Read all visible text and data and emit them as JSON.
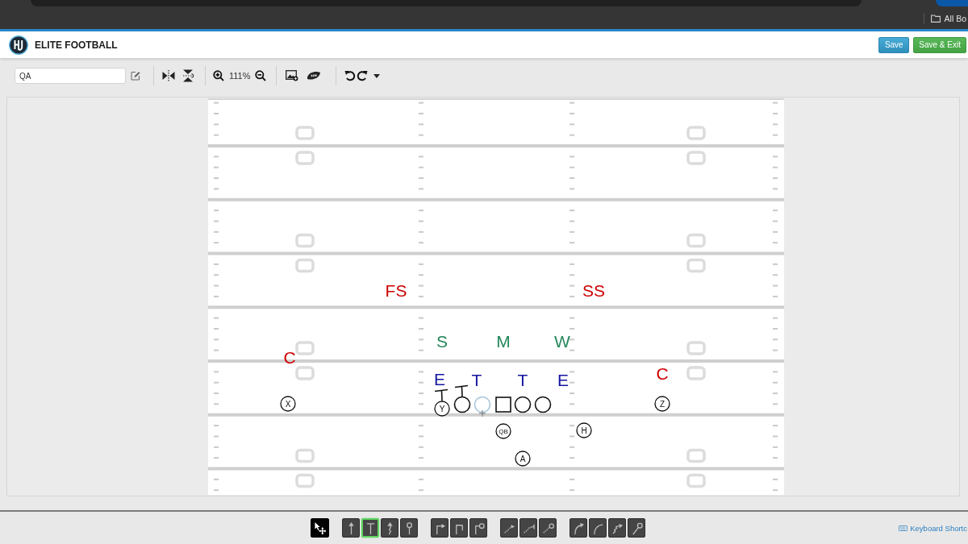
{
  "browser": {
    "bookmarks": "All Bo"
  },
  "header": {
    "app_name": "ELITE FOOTBALL",
    "buttons": [
      {
        "label": "Save",
        "kind": "save"
      },
      {
        "label": "Save & Exit",
        "kind": "save-exit"
      }
    ]
  },
  "toolbar": {
    "play_name": "QA",
    "zoom": "111%"
  },
  "field": {
    "defense": [
      {
        "label": "FS",
        "color": "#cc0000"
      },
      {
        "label": "SS",
        "color": "#cc0000"
      },
      {
        "label": "S",
        "color": "#23875a"
      },
      {
        "label": "M",
        "color": "#23875a"
      },
      {
        "label": "W",
        "color": "#23875a"
      },
      {
        "label": "C",
        "color": "#cc0000"
      },
      {
        "label": "C",
        "color": "#cc0000"
      },
      {
        "label": "E",
        "color": "#1414a0"
      },
      {
        "label": "T",
        "color": "#1414a0"
      },
      {
        "label": "T",
        "color": "#1414a0"
      },
      {
        "label": "E",
        "color": "#1414a0"
      }
    ],
    "offense": [
      {
        "label": "X",
        "kind": "circle",
        "selected": false,
        "block": false
      },
      {
        "label": "Y",
        "kind": "circle",
        "selected": false,
        "block": true
      },
      {
        "kind": "circle",
        "selected": false,
        "block": true
      },
      {
        "kind": "circle",
        "selected": true,
        "block": false
      },
      {
        "kind": "square",
        "selected": false,
        "block": false
      },
      {
        "kind": "circle",
        "selected": false,
        "block": false
      },
      {
        "kind": "circle",
        "selected": false,
        "block": false
      },
      {
        "label": "Z",
        "kind": "circle",
        "selected": false,
        "block": false
      },
      {
        "label": "QB",
        "kind": "circle",
        "selected": false,
        "block": false
      },
      {
        "label": "H",
        "kind": "circle",
        "selected": false,
        "block": false
      },
      {
        "label": "A",
        "kind": "circle",
        "selected": false,
        "block": false
      }
    ]
  },
  "tool_groups": [
    {
      "tools": [
        {
          "kind": "select",
          "selected": false
        }
      ]
    },
    {
      "tools": [
        {
          "kind": "arrow",
          "selected": false
        },
        {
          "kind": "block",
          "selected": true
        },
        {
          "kind": "wave",
          "selected": false
        },
        {
          "kind": "option",
          "selected": false
        }
      ]
    },
    {
      "tools": [
        {
          "kind": "out-arrow",
          "selected": false
        },
        {
          "kind": "out-block",
          "selected": false
        },
        {
          "kind": "out-option",
          "selected": false
        }
      ]
    },
    {
      "tools": [
        {
          "kind": "dash-arrow",
          "selected": false
        },
        {
          "kind": "dash-block",
          "selected": false
        },
        {
          "kind": "dash-option",
          "selected": false
        }
      ]
    },
    {
      "tools": [
        {
          "kind": "curve-arrow",
          "selected": false
        },
        {
          "kind": "curve-block",
          "selected": false
        },
        {
          "kind": "step-arrow",
          "selected": false
        },
        {
          "kind": "diag-option",
          "selected": false
        }
      ]
    }
  ],
  "shortcuts_link": "Keyboard Shortc"
}
